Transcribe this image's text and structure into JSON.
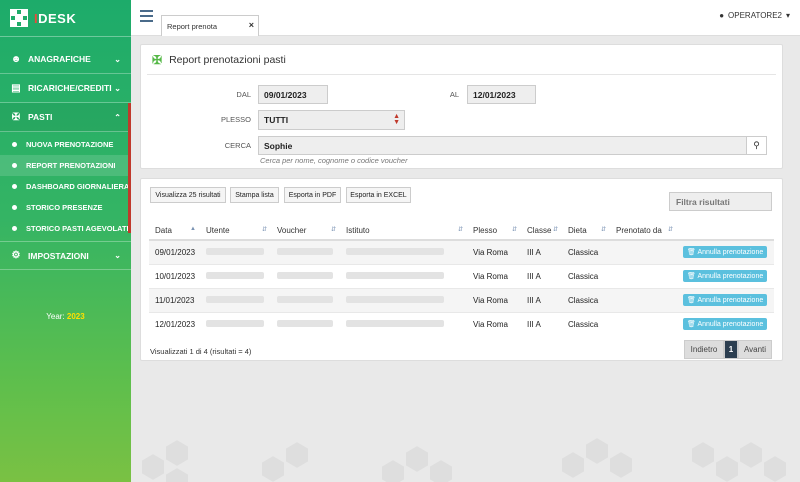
{
  "logo": {
    "text": "DESK",
    "initial": "I"
  },
  "sidebar": {
    "items": [
      {
        "label": "ANAGRAFICHE",
        "icon": "user-icon"
      },
      {
        "label": "RICARICHE/CREDITI",
        "icon": "credit-card-icon"
      },
      {
        "label": "PASTI",
        "icon": "cutlery-icon"
      },
      {
        "label": "IMPOSTAZIONI",
        "icon": "gears-icon"
      }
    ],
    "sub_items": [
      {
        "label": "NUOVA PRENOTAZIONE"
      },
      {
        "label": "REPORT PRENOTAZIONI"
      },
      {
        "label": "DASHBOARD GIORNALIERA"
      },
      {
        "label": "STORICO PRESENZE"
      },
      {
        "label": "STORICO PASTI AGEVOLATI"
      }
    ],
    "year_label": "Year:",
    "year_value": "2023"
  },
  "topbar": {
    "tab_label": "Report prenota",
    "tab_close": "×",
    "user_name": "OPERATORE2",
    "user_caret": "▾"
  },
  "filters": {
    "title": "Report prenotazioni pasti",
    "dal_label": "DAL",
    "dal_value": "09/01/2023",
    "al_label": "AL",
    "al_value": "12/01/2023",
    "plesso_label": "PLESSO",
    "plesso_value": "TUTTI",
    "cerca_label": "CERCA",
    "cerca_value": "Sophie",
    "cerca_hint": "Cerca per nome, cognome o codice voucher"
  },
  "actions": {
    "show25": "Visualizza 25 risultati",
    "print": "Stampa lista",
    "pdf": "Esporta in PDF",
    "excel": "Esporta in EXCEL",
    "filter_placeholder": "Filtra risultati"
  },
  "table": {
    "headers": [
      "Data",
      "Utente",
      "Voucher",
      "Istituto",
      "Plesso",
      "Classe",
      "Dieta",
      "Prenotato da",
      ""
    ],
    "rows": [
      {
        "data": "09/01/2023",
        "plesso": "Via Roma",
        "classe": "III A",
        "dieta": "Classica",
        "action": "Annulla prenotazione"
      },
      {
        "data": "10/01/2023",
        "plesso": "Via Roma",
        "classe": "III A",
        "dieta": "Classica",
        "action": "Annulla prenotazione"
      },
      {
        "data": "11/01/2023",
        "plesso": "Via Roma",
        "classe": "III A",
        "dieta": "Classica",
        "action": "Annulla prenotazione"
      },
      {
        "data": "12/01/2023",
        "plesso": "Via Roma",
        "classe": "III A",
        "dieta": "Classica",
        "action": "Annulla prenotazione"
      }
    ]
  },
  "footer": {
    "info": "Visualizzati 1 di 4 (risultati = 4)",
    "prev": "Indietro",
    "page": "1",
    "next": "Avanti"
  },
  "colors": {
    "accent": "#1dab6a",
    "danger": "#c0392b",
    "info": "#5bc0de"
  }
}
